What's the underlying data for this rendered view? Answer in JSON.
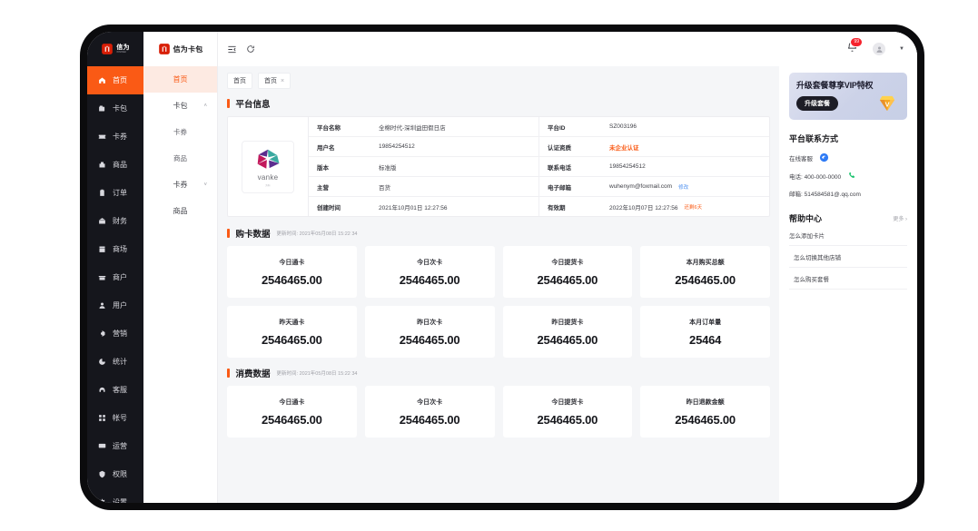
{
  "brand": {
    "rail_logo_text": "信为",
    "rail_logo_sub": "XINWEI",
    "panel_logo_text": "信为卡包"
  },
  "rail": {
    "items": [
      {
        "label": "首页",
        "icon": "home-icon"
      },
      {
        "label": "卡包",
        "icon": "wallet-icon"
      },
      {
        "label": "卡券",
        "icon": "ticket-icon"
      },
      {
        "label": "商品",
        "icon": "box-icon"
      },
      {
        "label": "订单",
        "icon": "clipboard-icon"
      },
      {
        "label": "财务",
        "icon": "bank-icon"
      },
      {
        "label": "商场",
        "icon": "shop-icon"
      },
      {
        "label": "商户",
        "icon": "store-icon"
      },
      {
        "label": "用户",
        "icon": "user-icon"
      },
      {
        "label": "营销",
        "icon": "megaphone-icon"
      },
      {
        "label": "统计",
        "icon": "chart-pie-icon"
      },
      {
        "label": "客服",
        "icon": "headset-icon"
      },
      {
        "label": "帐号",
        "icon": "grid-icon"
      },
      {
        "label": "运营",
        "icon": "monitor-icon"
      },
      {
        "label": "权限",
        "icon": "shield-icon"
      },
      {
        "label": "设置",
        "icon": "gear-icon"
      }
    ]
  },
  "submenu": {
    "items": [
      {
        "label": "首页",
        "level": "top",
        "caret": ""
      },
      {
        "label": "卡包",
        "level": "top",
        "caret": "˄"
      },
      {
        "label": "卡券",
        "level": "child",
        "caret": ""
      },
      {
        "label": "商品",
        "level": "child",
        "caret": ""
      },
      {
        "label": "卡券",
        "level": "top",
        "caret": "˅"
      },
      {
        "label": "商品",
        "level": "top",
        "caret": ""
      }
    ]
  },
  "topbar": {
    "collapse_icon": "menu-fold-icon",
    "refresh_icon": "refresh-icon",
    "bell_icon": "bell-icon",
    "notification_count": "99",
    "avatar_icon": "user-avatar-icon",
    "dropdown_caret": "▼"
  },
  "tabs": [
    {
      "label": "首页",
      "closable": false,
      "close": ""
    },
    {
      "label": "首页",
      "closable": true,
      "close": "×"
    }
  ],
  "platform_info": {
    "section_title": "平台信息",
    "logo_word": "vanke",
    "logo_sub": "万科",
    "rows": [
      {
        "label": "平台名称",
        "value": "全棉时代-深圳益田假日店",
        "label2": "平台ID",
        "value2": "SZ003196",
        "tag2": "",
        "tag2_type": ""
      },
      {
        "label": "用户名",
        "value": "19854254512",
        "label2": "认证资质",
        "value2": "未企业认证",
        "value2_type": "warn",
        "tag2": "",
        "tag2_type": ""
      },
      {
        "label": "版本",
        "value": "标准版",
        "label2": "联系电话",
        "value2": "19854254512",
        "tag2": "",
        "tag2_type": ""
      },
      {
        "label": "主营",
        "value": "百货",
        "label2": "电子邮箱",
        "value2": "wuhenym@foxmail.com",
        "tag2": "修改",
        "tag2_type": "link"
      },
      {
        "label": "创建时间",
        "value": "2021年10月01日 12:27:56",
        "label2": "有效期",
        "value2": "2022年10月07日 12:27:56",
        "tag2": "还剩6天",
        "tag2_type": "danger"
      }
    ]
  },
  "purchase_section": {
    "title": "购卡数据",
    "meta": "更新时间: 2021年05月08日 15:22 34",
    "cards": [
      {
        "label": "今日通卡",
        "value": "2546465.00"
      },
      {
        "label": "今日次卡",
        "value": "2546465.00"
      },
      {
        "label": "今日提货卡",
        "value": "2546465.00"
      },
      {
        "label": "本月购买总额",
        "value": "2546465.00"
      },
      {
        "label": "昨天通卡",
        "value": "2546465.00"
      },
      {
        "label": "昨日次卡",
        "value": "2546465.00"
      },
      {
        "label": "昨日提货卡",
        "value": "2546465.00"
      },
      {
        "label": "本月订单量",
        "value": "25464"
      }
    ]
  },
  "consume_section": {
    "title": "消费数据",
    "meta": "更新时间: 2021年05月08日 15:22 34",
    "cards": [
      {
        "label": "今日通卡",
        "value": "2546465.00"
      },
      {
        "label": "今日次卡",
        "value": "2546465.00"
      },
      {
        "label": "今日提货卡",
        "value": "2546465.00"
      },
      {
        "label": "昨日退款金额",
        "value": "2546465.00"
      }
    ]
  },
  "right_panel": {
    "promo": {
      "title": "升级套餐尊享VIP特权",
      "button": "升级套餐",
      "gem_icon": "vip-diamond-icon"
    },
    "contact": {
      "title": "平台联系方式",
      "service_label": "在线客服",
      "service_icon": "chat-bubble-icon",
      "phone_label": "电话: 400-000-0000",
      "phone_icon": "phone-icon",
      "email_label": "邮箱: 514584581@.qq.com"
    },
    "help": {
      "title": "帮助中心",
      "more": "更多 ›",
      "items": [
        {
          "label": "怎么添加卡片"
        },
        {
          "label": "怎么切换其他店铺"
        },
        {
          "label": "怎么购买套餐"
        }
      ]
    }
  },
  "colors": {
    "accent": "#fa5a15",
    "rail_bg": "#15161c",
    "page_bg": "#f5f6f8",
    "link": "#4a8ef0",
    "danger": "#f5222d"
  }
}
